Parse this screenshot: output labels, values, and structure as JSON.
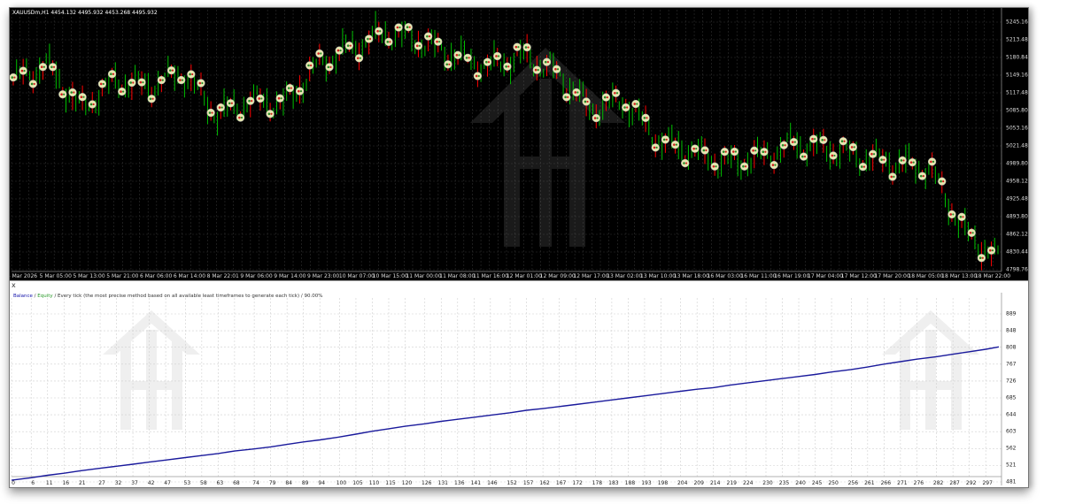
{
  "price_chart": {
    "symbol_info": "XAUUSDm,H1  4454.132 4495.932 4453.268 4495.932",
    "price_labels": [
      "5245.160",
      "5213.480",
      "5180.840",
      "5149.160",
      "5117.480",
      "5085.800",
      "5053.160",
      "5021.480",
      "4989.800",
      "4958.120",
      "4925.480",
      "4893.800",
      "4862.120",
      "4830.440",
      "4798.760"
    ],
    "time_labels": [
      "4 Mar 2026",
      "5 Mar 05:00",
      "5 Mar 13:00",
      "5 Mar 21:00",
      "6 Mar 06:00",
      "6 Mar 14:00",
      "8 Mar 22:01",
      "9 Mar 06:00",
      "9 Mar 14:00",
      "9 Mar 23:00",
      "10 Mar 07:00",
      "10 Mar 15:00",
      "11 Mar 00:00",
      "11 Mar 08:00",
      "11 Mar 16:00",
      "12 Mar 01:00",
      "12 Mar 09:00",
      "12 Mar 17:00",
      "13 Mar 02:00",
      "13 Mar 10:00",
      "13 Mar 18:00",
      "16 Mar 03:00",
      "16 Mar 11:00",
      "16 Mar 19:00",
      "17 Mar 04:00",
      "17 Mar 12:00",
      "17 Mar 20:00",
      "18 Mar 05:00",
      "18 Mar 13:00",
      "18 Mar 22:00"
    ],
    "colors": {
      "background": "#000000",
      "grid": "#2f2f2f",
      "bull": "#00c000",
      "bear": "#ff0000",
      "trade_marker": "#e8e8b0"
    }
  },
  "equity_chart": {
    "legend": {
      "balance": "Balance",
      "sep1": " / ",
      "equity": "Equity",
      "rest": " / Every tick (the most precise method based on all available least timeframes to generate each tick) / 90.00%"
    },
    "close_label": "x",
    "y_labels": [
      "889",
      "848",
      "808",
      "767",
      "726",
      "685",
      "644",
      "603",
      "562",
      "521",
      "481"
    ],
    "x_labels": [
      "0",
      "6",
      "11",
      "16",
      "21",
      "27",
      "32",
      "37",
      "42",
      "47",
      "53",
      "58",
      "63",
      "68",
      "74",
      "79",
      "84",
      "89",
      "94",
      "100",
      "105",
      "110",
      "115",
      "120",
      "126",
      "131",
      "136",
      "141",
      "146",
      "152",
      "157",
      "162",
      "167",
      "172",
      "178",
      "183",
      "188",
      "193",
      "198",
      "204",
      "209",
      "214",
      "219",
      "224",
      "230",
      "235",
      "240",
      "245",
      "250",
      "256",
      "261",
      "266",
      "271",
      "276",
      "282",
      "287",
      "292",
      "297"
    ],
    "colors": {
      "balance": "#1a1a9c",
      "grid": "#d0d0d0"
    }
  },
  "chart_data": [
    {
      "type": "line",
      "title": "XAUUSDm,H1",
      "x": [
        "4 Mar 2026",
        "5 Mar 05:00",
        "5 Mar 13:00",
        "5 Mar 21:00",
        "6 Mar 06:00",
        "6 Mar 14:00",
        "8 Mar 22:01",
        "9 Mar 06:00",
        "9 Mar 14:00",
        "9 Mar 23:00",
        "10 Mar 07:00",
        "10 Mar 15:00",
        "11 Mar 00:00",
        "11 Mar 08:00",
        "11 Mar 16:00",
        "12 Mar 01:00",
        "12 Mar 09:00",
        "12 Mar 17:00",
        "13 Mar 02:00",
        "13 Mar 10:00",
        "13 Mar 18:00",
        "16 Mar 03:00",
        "16 Mar 11:00",
        "16 Mar 19:00",
        "17 Mar 04:00",
        "17 Mar 12:00",
        "17 Mar 20:00",
        "18 Mar 05:00",
        "18 Mar 13:00",
        "18 Mar 22:00"
      ],
      "series": [
        {
          "values": [
            5135,
            5165,
            5085,
            5135,
            5125,
            5150,
            5075,
            5100,
            5095,
            5165,
            5195,
            5220,
            5205,
            5180,
            5160,
            5180,
            5150,
            5085,
            5100,
            5030,
            5010,
            4990,
            5000,
            5025,
            5015,
            5000,
            4990,
            4980,
            4870,
            4820
          ]
        }
      ],
      "ylim": [
        4798.76,
        5245.16
      ],
      "grid": true
    },
    {
      "type": "line",
      "x": [
        0,
        6,
        11,
        16,
        21,
        27,
        32,
        37,
        42,
        47,
        53,
        58,
        63,
        68,
        74,
        79,
        84,
        89,
        94,
        100,
        105,
        110,
        115,
        120,
        126,
        131,
        136,
        141,
        146,
        152,
        157,
        162,
        167,
        172,
        178,
        183,
        188,
        193,
        198,
        204,
        209,
        214,
        219,
        224,
        230,
        235,
        240,
        245,
        250,
        256,
        261,
        266,
        271,
        276,
        282,
        287,
        292,
        297,
        301
      ],
      "series": [
        {
          "name": "Balance",
          "values": [
            485,
            491,
            497,
            502,
            508,
            514,
            519,
            524,
            529,
            534,
            540,
            545,
            550,
            556,
            561,
            566,
            572,
            578,
            583,
            590,
            597,
            604,
            610,
            616,
            622,
            628,
            633,
            638,
            643,
            649,
            655,
            659,
            664,
            669,
            675,
            680,
            685,
            690,
            695,
            701,
            706,
            710,
            716,
            721,
            727,
            732,
            737,
            742,
            748,
            754,
            760,
            767,
            773,
            779,
            785,
            791,
            797,
            803,
            809
          ]
        }
      ],
      "ylim": [
        481,
        889
      ],
      "grid": true
    }
  ]
}
